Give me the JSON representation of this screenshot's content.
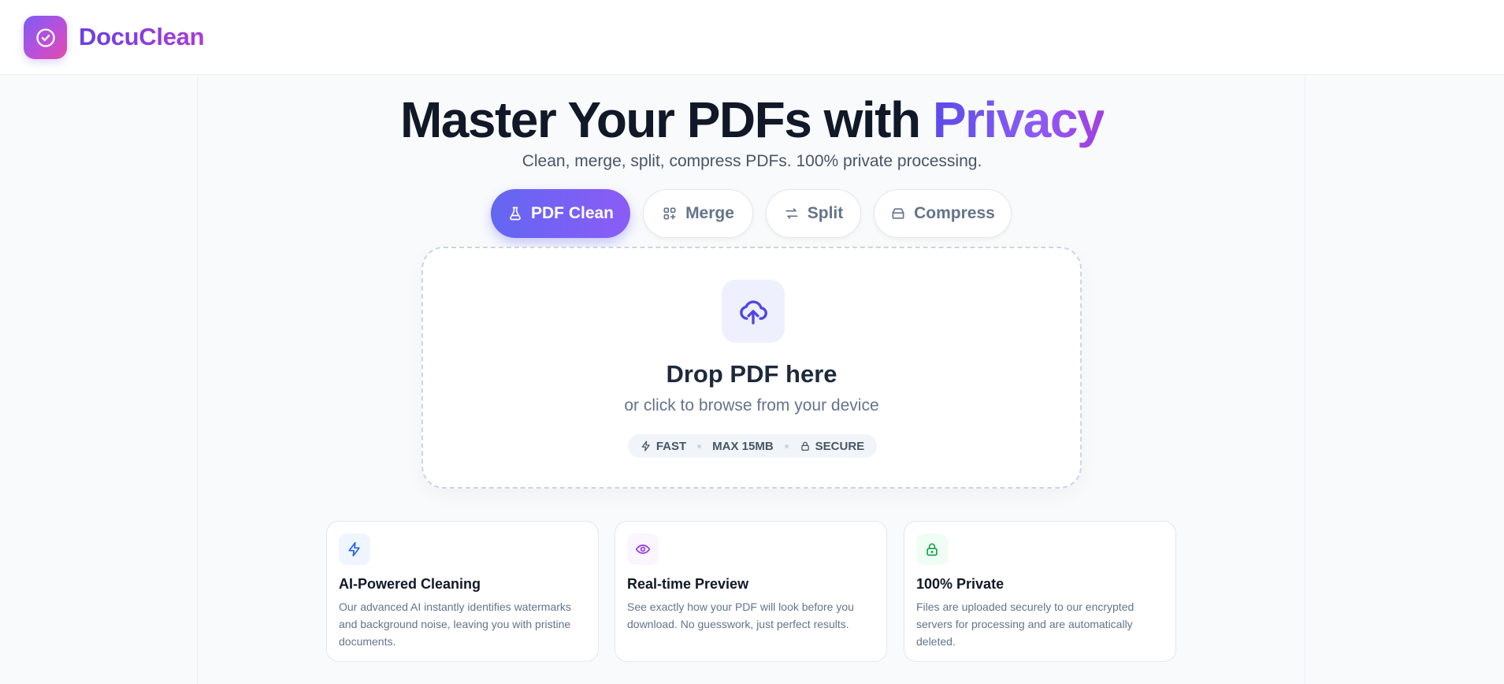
{
  "brand": {
    "name": "DocuClean",
    "logo_icon": "check-circle-icon"
  },
  "hero": {
    "title_main": "Master Your PDFs with ",
    "title_accent": "Privacy",
    "subtitle": "Clean, merge, split, compress PDFs. 100% private processing."
  },
  "tabs": [
    {
      "label": "PDF Clean",
      "icon": "flask-icon",
      "active": true
    },
    {
      "label": "Merge",
      "icon": "grid-plus-icon",
      "active": false
    },
    {
      "label": "Split",
      "icon": "arrows-swap-icon",
      "active": false
    },
    {
      "label": "Compress",
      "icon": "archive-icon",
      "active": false
    }
  ],
  "dropzone": {
    "icon": "cloud-upload-icon",
    "title": "Drop PDF here",
    "subtitle": "or click to browse from your device",
    "chips": [
      "FAST",
      "MAX 15MB",
      "SECURE"
    ]
  },
  "features": [
    {
      "icon": "lightning-icon",
      "title": "AI-Powered Cleaning",
      "description": "Our advanced AI instantly identifies watermarks and background noise, leaving you with pristine documents."
    },
    {
      "icon": "eye-icon",
      "title": "Real-time Preview",
      "description": "See exactly how your PDF will look before you download. No guesswork, just perfect results."
    },
    {
      "icon": "lock-icon",
      "title": "100% Private",
      "description": "Files are uploaded securely to our encrypted servers for processing and are automatically deleted."
    }
  ],
  "colors": {
    "primary": "#6366f1",
    "accent": "#8b5cf6",
    "feature_icon_blue": "#eff6ff",
    "feature_icon_purple": "#faf5ff",
    "feature_icon_green": "#f0fdf4"
  }
}
